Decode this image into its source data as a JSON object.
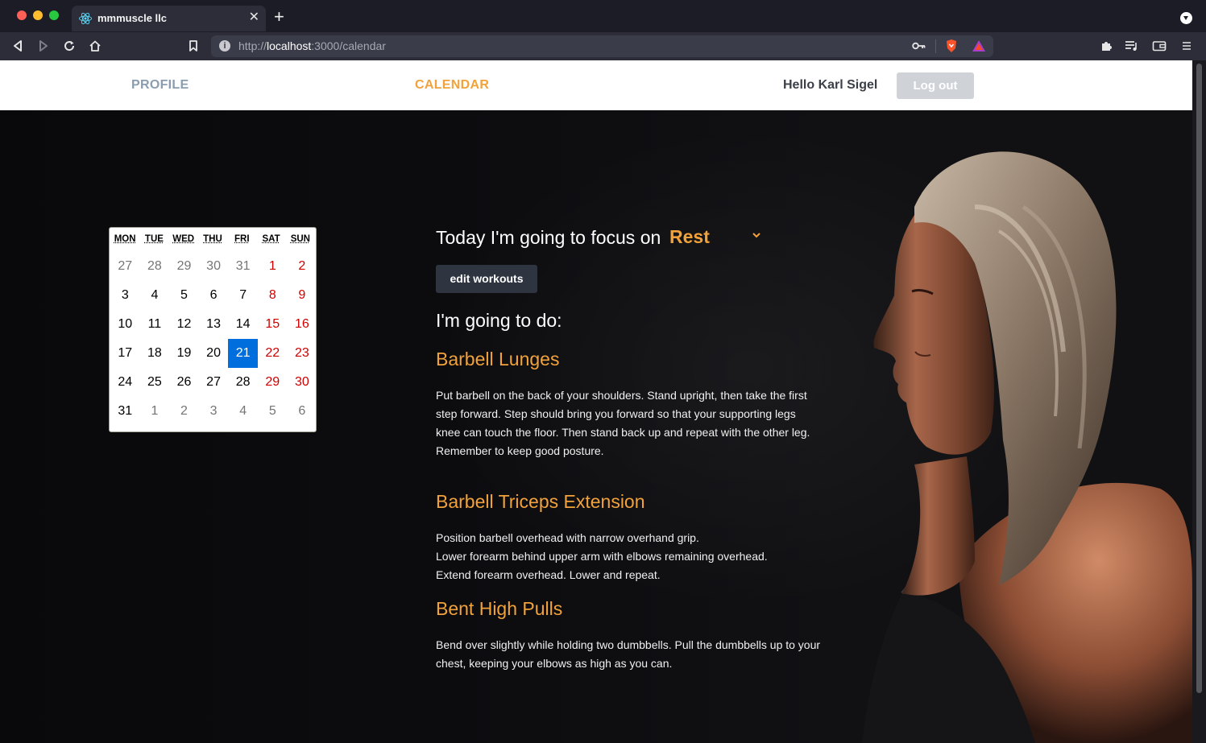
{
  "browser": {
    "tab_title": "mmmuscle llc",
    "url_scheme": "http://",
    "url_host": "localhost",
    "url_path": ":3000/calendar"
  },
  "nav": {
    "profile": "PROFILE",
    "calendar": "CALENDAR",
    "greeting": "Hello Karl Sigel",
    "logout": "Log out"
  },
  "calendar": {
    "weekdays": [
      "MON",
      "TUE",
      "WED",
      "THU",
      "FRI",
      "SAT",
      "SUN"
    ],
    "weeks": [
      [
        "27",
        "28",
        "29",
        "30",
        "31",
        "1",
        "2"
      ],
      [
        "3",
        "4",
        "5",
        "6",
        "7",
        "8",
        "9"
      ],
      [
        "10",
        "11",
        "12",
        "13",
        "14",
        "15",
        "16"
      ],
      [
        "17",
        "18",
        "19",
        "20",
        "21",
        "22",
        "23"
      ],
      [
        "24",
        "25",
        "26",
        "27",
        "28",
        "29",
        "30"
      ],
      [
        "31",
        "1",
        "2",
        "3",
        "4",
        "5",
        "6"
      ]
    ],
    "selected_day": "21",
    "colors": {
      "weekend": "#d10000",
      "selected": "#006edc",
      "outside": "#757575"
    }
  },
  "focus": {
    "prefix": "Today I'm going to focus on",
    "value": "Rest",
    "edit_button": "edit workouts",
    "going_to_do": "I'm going to do:"
  },
  "workouts": [
    {
      "title": "Barbell Lunges",
      "lines": [
        "Put barbell on the back of your shoulders. Stand upright, then take the first step forward. Step should bring you forward so that your supporting legs knee can touch the floor. Then stand back up and repeat with the other leg.",
        "Remember to keep good posture."
      ]
    },
    {
      "title": "Barbell Triceps Extension",
      "lines": [
        "Position barbell overhead with narrow overhand grip.",
        "Lower forearm behind upper arm with elbows remaining overhead.",
        "Extend forearm overhead. Lower and repeat."
      ]
    },
    {
      "title": "Bent High Pulls",
      "lines": [
        "Bend over slightly while holding two dumbbells.  Pull the dumbbells up to your chest, keeping your elbows as high as you can."
      ]
    }
  ],
  "theme": {
    "accent": "#f2a23a",
    "nav_profile": "#8a9db0"
  }
}
